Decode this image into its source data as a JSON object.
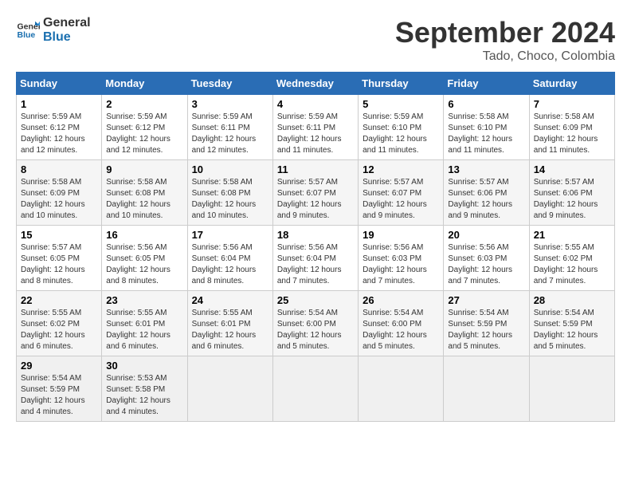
{
  "header": {
    "logo_line1": "General",
    "logo_line2": "Blue",
    "month": "September 2024",
    "location": "Tado, Choco, Colombia"
  },
  "days_of_week": [
    "Sunday",
    "Monday",
    "Tuesday",
    "Wednesday",
    "Thursday",
    "Friday",
    "Saturday"
  ],
  "weeks": [
    [
      {
        "day": "1",
        "sunrise": "5:59 AM",
        "sunset": "6:12 PM",
        "daylight": "12 hours and 12 minutes."
      },
      {
        "day": "2",
        "sunrise": "5:59 AM",
        "sunset": "6:12 PM",
        "daylight": "12 hours and 12 minutes."
      },
      {
        "day": "3",
        "sunrise": "5:59 AM",
        "sunset": "6:11 PM",
        "daylight": "12 hours and 12 minutes."
      },
      {
        "day": "4",
        "sunrise": "5:59 AM",
        "sunset": "6:11 PM",
        "daylight": "12 hours and 11 minutes."
      },
      {
        "day": "5",
        "sunrise": "5:59 AM",
        "sunset": "6:10 PM",
        "daylight": "12 hours and 11 minutes."
      },
      {
        "day": "6",
        "sunrise": "5:58 AM",
        "sunset": "6:10 PM",
        "daylight": "12 hours and 11 minutes."
      },
      {
        "day": "7",
        "sunrise": "5:58 AM",
        "sunset": "6:09 PM",
        "daylight": "12 hours and 11 minutes."
      }
    ],
    [
      {
        "day": "8",
        "sunrise": "5:58 AM",
        "sunset": "6:09 PM",
        "daylight": "12 hours and 10 minutes."
      },
      {
        "day": "9",
        "sunrise": "5:58 AM",
        "sunset": "6:08 PM",
        "daylight": "12 hours and 10 minutes."
      },
      {
        "day": "10",
        "sunrise": "5:58 AM",
        "sunset": "6:08 PM",
        "daylight": "12 hours and 10 minutes."
      },
      {
        "day": "11",
        "sunrise": "5:57 AM",
        "sunset": "6:07 PM",
        "daylight": "12 hours and 9 minutes."
      },
      {
        "day": "12",
        "sunrise": "5:57 AM",
        "sunset": "6:07 PM",
        "daylight": "12 hours and 9 minutes."
      },
      {
        "day": "13",
        "sunrise": "5:57 AM",
        "sunset": "6:06 PM",
        "daylight": "12 hours and 9 minutes."
      },
      {
        "day": "14",
        "sunrise": "5:57 AM",
        "sunset": "6:06 PM",
        "daylight": "12 hours and 9 minutes."
      }
    ],
    [
      {
        "day": "15",
        "sunrise": "5:57 AM",
        "sunset": "6:05 PM",
        "daylight": "12 hours and 8 minutes."
      },
      {
        "day": "16",
        "sunrise": "5:56 AM",
        "sunset": "6:05 PM",
        "daylight": "12 hours and 8 minutes."
      },
      {
        "day": "17",
        "sunrise": "5:56 AM",
        "sunset": "6:04 PM",
        "daylight": "12 hours and 8 minutes."
      },
      {
        "day": "18",
        "sunrise": "5:56 AM",
        "sunset": "6:04 PM",
        "daylight": "12 hours and 7 minutes."
      },
      {
        "day": "19",
        "sunrise": "5:56 AM",
        "sunset": "6:03 PM",
        "daylight": "12 hours and 7 minutes."
      },
      {
        "day": "20",
        "sunrise": "5:56 AM",
        "sunset": "6:03 PM",
        "daylight": "12 hours and 7 minutes."
      },
      {
        "day": "21",
        "sunrise": "5:55 AM",
        "sunset": "6:02 PM",
        "daylight": "12 hours and 7 minutes."
      }
    ],
    [
      {
        "day": "22",
        "sunrise": "5:55 AM",
        "sunset": "6:02 PM",
        "daylight": "12 hours and 6 minutes."
      },
      {
        "day": "23",
        "sunrise": "5:55 AM",
        "sunset": "6:01 PM",
        "daylight": "12 hours and 6 minutes."
      },
      {
        "day": "24",
        "sunrise": "5:55 AM",
        "sunset": "6:01 PM",
        "daylight": "12 hours and 6 minutes."
      },
      {
        "day": "25",
        "sunrise": "5:54 AM",
        "sunset": "6:00 PM",
        "daylight": "12 hours and 5 minutes."
      },
      {
        "day": "26",
        "sunrise": "5:54 AM",
        "sunset": "6:00 PM",
        "daylight": "12 hours and 5 minutes."
      },
      {
        "day": "27",
        "sunrise": "5:54 AM",
        "sunset": "5:59 PM",
        "daylight": "12 hours and 5 minutes."
      },
      {
        "day": "28",
        "sunrise": "5:54 AM",
        "sunset": "5:59 PM",
        "daylight": "12 hours and 5 minutes."
      }
    ],
    [
      {
        "day": "29",
        "sunrise": "5:54 AM",
        "sunset": "5:59 PM",
        "daylight": "12 hours and 4 minutes."
      },
      {
        "day": "30",
        "sunrise": "5:53 AM",
        "sunset": "5:58 PM",
        "daylight": "12 hours and 4 minutes."
      },
      null,
      null,
      null,
      null,
      null
    ]
  ],
  "labels": {
    "sunrise_label": "Sunrise:",
    "sunset_label": "Sunset:",
    "daylight_label": "Daylight:"
  }
}
